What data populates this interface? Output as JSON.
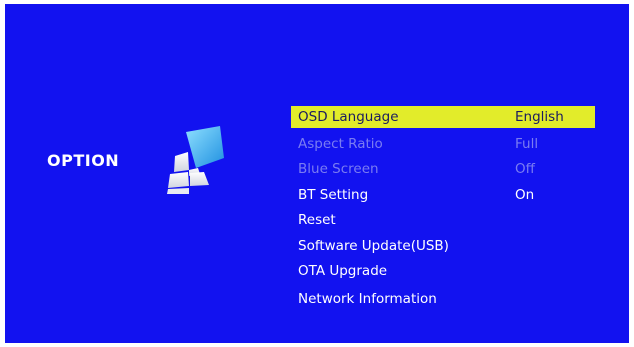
{
  "page": {
    "title": "OPTION"
  },
  "colors": {
    "background": "#1212f0",
    "highlight": "#e2ec2a",
    "highlight_text": "#1b1b60",
    "disabled_text": "#7a7cf2",
    "text": "#ffffff"
  },
  "icon": "option-tiles-icon",
  "menu": [
    {
      "label": "OSD Language",
      "value": "English",
      "selected": true,
      "enabled": true
    },
    {
      "label": "Aspect Ratio",
      "value": "Full",
      "selected": false,
      "enabled": false
    },
    {
      "label": "Blue Screen",
      "value": "Off",
      "selected": false,
      "enabled": false
    },
    {
      "label": "BT Setting",
      "value": "On",
      "selected": false,
      "enabled": true
    },
    {
      "label": "Reset",
      "value": "",
      "selected": false,
      "enabled": true
    },
    {
      "label": "Software Update(USB)",
      "value": "",
      "selected": false,
      "enabled": true
    },
    {
      "label": "OTA Upgrade",
      "value": "",
      "selected": false,
      "enabled": true
    },
    {
      "label": "Network Information",
      "value": "",
      "selected": false,
      "enabled": true
    }
  ]
}
